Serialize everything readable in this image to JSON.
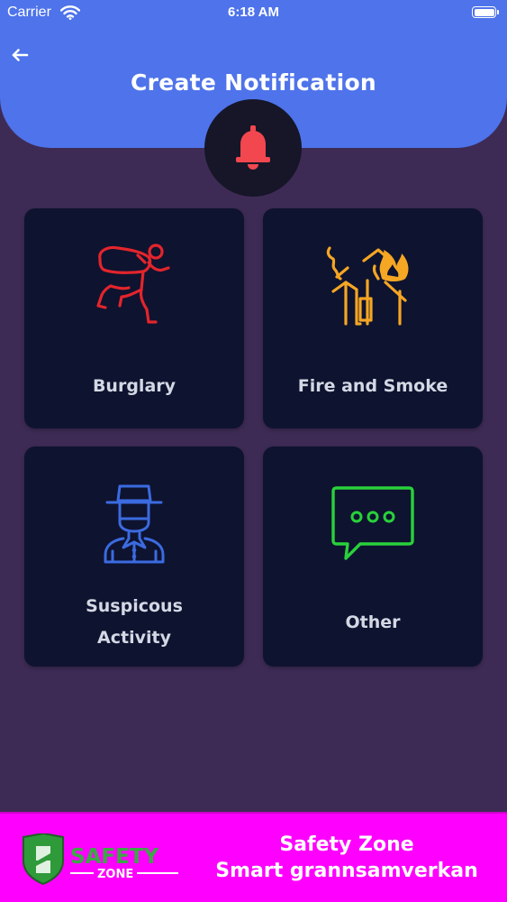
{
  "status_bar": {
    "carrier": "Carrier",
    "time": "6:18 AM"
  },
  "header": {
    "title": "Create Notification",
    "back_icon": "arrow-left-icon",
    "bell_icon": "bell-icon",
    "bell_color": "#f2474f",
    "background": "#4e73ea"
  },
  "categories": [
    {
      "label": "Burglary",
      "icon": "burglar-icon",
      "color": "#e3252b"
    },
    {
      "label": "Fire and Smoke",
      "icon": "house-fire-icon",
      "color": "#f5a623"
    },
    {
      "label_line1": "Suspicous",
      "label_line2": "Activity",
      "icon": "hat-man-icon",
      "color": "#3b6be0"
    },
    {
      "label": "Other",
      "icon": "chat-bubble-icon",
      "color": "#29d13a"
    }
  ],
  "banner": {
    "logo_text": "SAFETY",
    "logo_subtext": "ZONE",
    "line1": "Safety Zone",
    "line2": "Smart grannsamverkan",
    "background": "#fe00fe"
  }
}
